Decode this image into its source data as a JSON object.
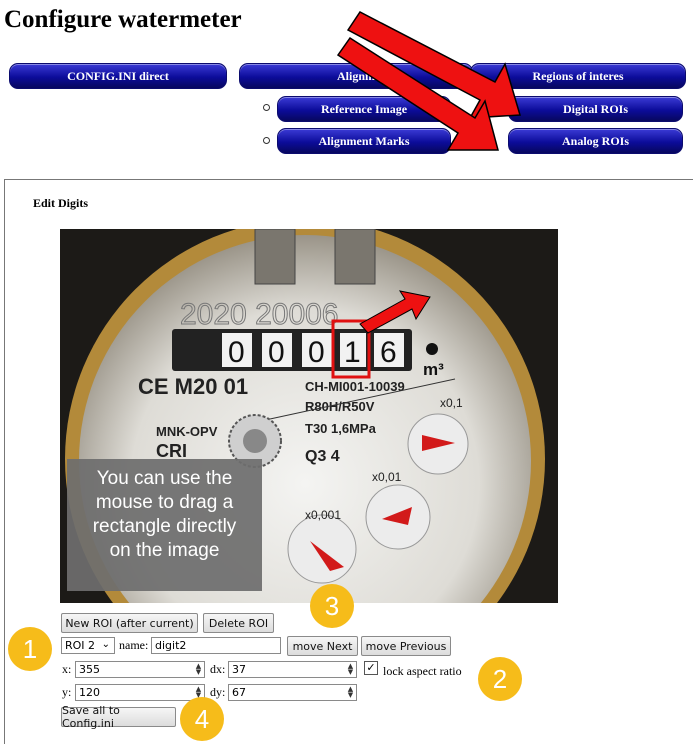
{
  "header": {
    "title": "Configure watermeter"
  },
  "nav": {
    "config_ini": "CONFIG.INI direct",
    "alignment": "Alignm",
    "regions": "Regions of interes",
    "reference_image": "Reference Image",
    "digital_rois": "Digital ROIs",
    "alignment_marks": "Alignment Marks",
    "analog_rois": "Analog ROIs"
  },
  "panel": {
    "heading": "Edit Digits"
  },
  "meter": {
    "serial": "2020 20006",
    "digits": [
      "0",
      "0",
      "0",
      "1",
      "6"
    ],
    "unit": "m³",
    "brand": "CE M20 01",
    "model": "CH-MI001-10039",
    "spec1": "R80H/R50V",
    "spec2": "T30  1,6MPa",
    "left1": "MNK-OPV",
    "left2": "CRI",
    "q": "Q3 4",
    "dial1": "x0,1",
    "dial2": "x0,01",
    "dial3": "x0,001"
  },
  "tooltip": {
    "text": [
      "You can use the",
      "mouse to drag a",
      "rectangle directly",
      "on the image"
    ]
  },
  "controls": {
    "new_roi": "New ROI (after current)",
    "delete_roi": "Delete ROI",
    "roi_select": "ROI 2",
    "name_label": "name:",
    "name_value": "digit2",
    "move_next": "move Next",
    "move_previous": "move Previous",
    "x_label": "x:",
    "x_value": "355",
    "dx_label": "dx:",
    "dx_value": "37",
    "lock_label": "lock aspect ratio",
    "lock_checked": true,
    "y_label": "y:",
    "y_value": "120",
    "dy_label": "dy:",
    "dy_value": "67",
    "save": "Save all to Config.ini"
  },
  "callouts": [
    "1",
    "2",
    "3",
    "4"
  ],
  "colors": {
    "nav_button": "#0c0c9a",
    "arrow": "#ee1111",
    "callout": "#f6bc1a",
    "roi_box": "#e01010"
  }
}
